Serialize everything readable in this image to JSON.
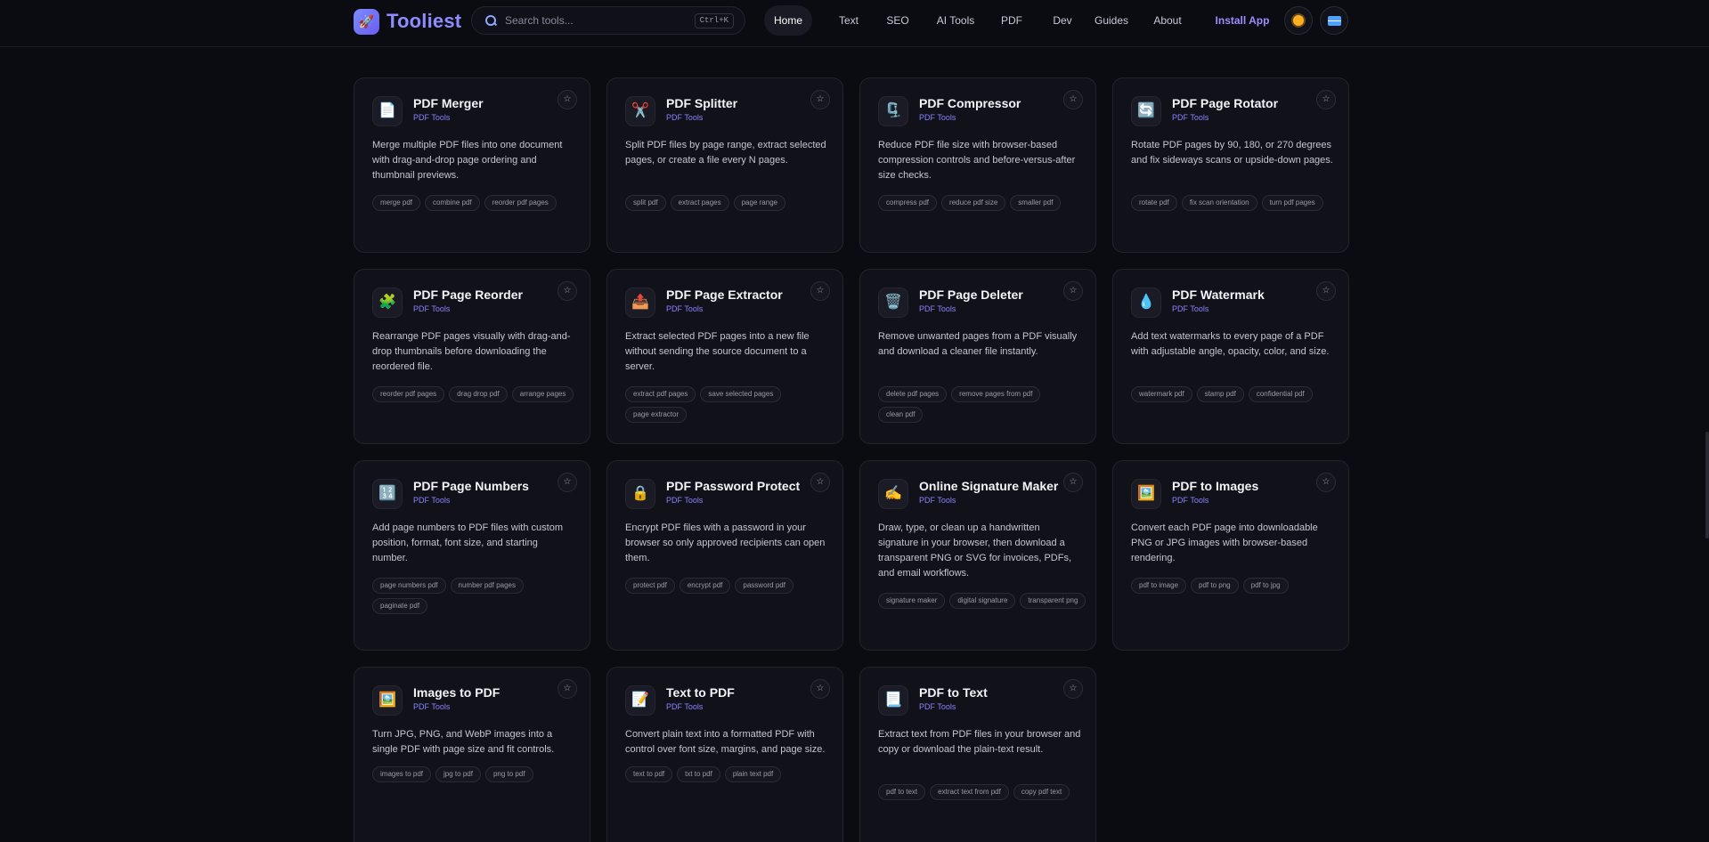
{
  "brand": {
    "name": "Tooliest",
    "logo_icon": "rocket-icon"
  },
  "search": {
    "placeholder": "Search tools...",
    "shortcut": "Ctrl+K"
  },
  "nav": {
    "items": [
      "Home",
      "Text",
      "SEO",
      "AI Tools",
      "PDF",
      "Dev",
      "Guides",
      "About"
    ],
    "active": "Home",
    "install_label": "Install App",
    "theme_icon": "sun-icon",
    "language_icon": "flag-icon"
  },
  "colors": {
    "accent": "#8f8cff",
    "background": "#0b0b12",
    "card": "#111119"
  },
  "cards": [
    {
      "title": "PDF Merger",
      "category": "PDF Tools",
      "icon": "📄",
      "icon_name": "document-icon",
      "description": "Merge multiple PDF files into one document with drag-and-drop page ordering and thumbnail previews.",
      "tags": [
        "merge pdf",
        "combine pdf",
        "reorder pdf pages"
      ]
    },
    {
      "title": "PDF Splitter",
      "category": "PDF Tools",
      "icon": "✂️",
      "icon_name": "scissors-icon",
      "description": "Split PDF files by page range, extract selected pages, or create a file every N pages.",
      "tags": [
        "split pdf",
        "extract pages",
        "page range"
      ]
    },
    {
      "title": "PDF Compressor",
      "category": "PDF Tools",
      "icon": "🗜️",
      "icon_name": "clamp-icon",
      "description": "Reduce PDF file size with browser-based compression controls and before-versus-after size checks.",
      "tags": [
        "compress pdf",
        "reduce pdf size",
        "smaller pdf"
      ]
    },
    {
      "title": "PDF Page Rotator",
      "category": "PDF Tools",
      "icon": "🔄",
      "icon_name": "rotate-icon",
      "description": "Rotate PDF pages by 90, 180, or 270 degrees and fix sideways scans or upside-down pages.",
      "tags": [
        "rotate pdf",
        "fix scan orientation",
        "turn pdf pages"
      ]
    },
    {
      "title": "PDF Page Reorder",
      "category": "PDF Tools",
      "icon": "🧩",
      "icon_name": "puzzle-icon",
      "description": "Rearrange PDF pages visually with drag-and-drop thumbnails before downloading the reordered file.",
      "tags": [
        "reorder pdf pages",
        "drag drop pdf",
        "arrange pages"
      ]
    },
    {
      "title": "PDF Page Extractor",
      "category": "PDF Tools",
      "icon": "📤",
      "icon_name": "outbox-icon",
      "description": "Extract selected PDF pages into a new file without sending the source document to a server.",
      "tags": [
        "extract pdf pages",
        "save selected pages",
        "page extractor"
      ]
    },
    {
      "title": "PDF Page Deleter",
      "category": "PDF Tools",
      "icon": "🗑️",
      "icon_name": "trash-icon",
      "description": "Remove unwanted pages from a PDF visually and download a cleaner file instantly.",
      "tags": [
        "delete pdf pages",
        "remove pages from pdf",
        "clean pdf"
      ]
    },
    {
      "title": "PDF Watermark",
      "category": "PDF Tools",
      "icon": "💧",
      "icon_name": "droplet-icon",
      "description": "Add text watermarks to every page of a PDF with adjustable angle, opacity, color, and size.",
      "tags": [
        "watermark pdf",
        "stamp pdf",
        "confidential pdf"
      ]
    },
    {
      "title": "PDF Page Numbers",
      "category": "PDF Tools",
      "icon": "🔢",
      "icon_name": "numbers-icon",
      "description": "Add page numbers to PDF files with custom position, format, font size, and starting number.",
      "tags": [
        "page numbers pdf",
        "number pdf pages",
        "paginate pdf"
      ]
    },
    {
      "title": "PDF Password Protect",
      "category": "PDF Tools",
      "icon": "🔒",
      "icon_name": "lock-icon",
      "description": "Encrypt PDF files with a password in your browser so only approved recipients can open them.",
      "tags": [
        "protect pdf",
        "encrypt pdf",
        "password pdf"
      ]
    },
    {
      "title": "Online Signature Maker",
      "category": "PDF Tools",
      "icon": "✍️",
      "icon_name": "writing-hand-icon",
      "description": "Draw, type, or clean up a handwritten signature in your browser, then download a transparent PNG or SVG for invoices, PDFs, and email workflows.",
      "tags": [
        "signature maker",
        "digital signature",
        "transparent png"
      ]
    },
    {
      "title": "PDF to Images",
      "category": "PDF Tools",
      "icon": "🖼️",
      "icon_name": "picture-icon",
      "description": "Convert each PDF page into downloadable PNG or JPG images with browser-based rendering.",
      "tags": [
        "pdf to image",
        "pdf to png",
        "pdf to jpg"
      ]
    },
    {
      "title": "Images to PDF",
      "category": "PDF Tools",
      "icon": "🖼️",
      "icon_name": "picture-icon",
      "description": "Turn JPG, PNG, and WebP images into a single PDF with page size and fit controls.",
      "tags": [
        "images to pdf",
        "jpg to pdf",
        "png to pdf"
      ]
    },
    {
      "title": "Text to PDF",
      "category": "PDF Tools",
      "icon": "📝",
      "icon_name": "memo-icon",
      "description": "Convert plain text into a formatted PDF with control over font size, margins, and page size.",
      "tags": [
        "text to pdf",
        "txt to pdf",
        "plain text pdf"
      ]
    },
    {
      "title": "PDF to Text",
      "category": "PDF Tools",
      "icon": "📃",
      "icon_name": "page-text-icon",
      "description": "Extract text from PDF files in your browser and copy or download the plain-text result.",
      "tags": [
        "pdf to text",
        "extract text from pdf",
        "copy pdf text"
      ]
    }
  ]
}
